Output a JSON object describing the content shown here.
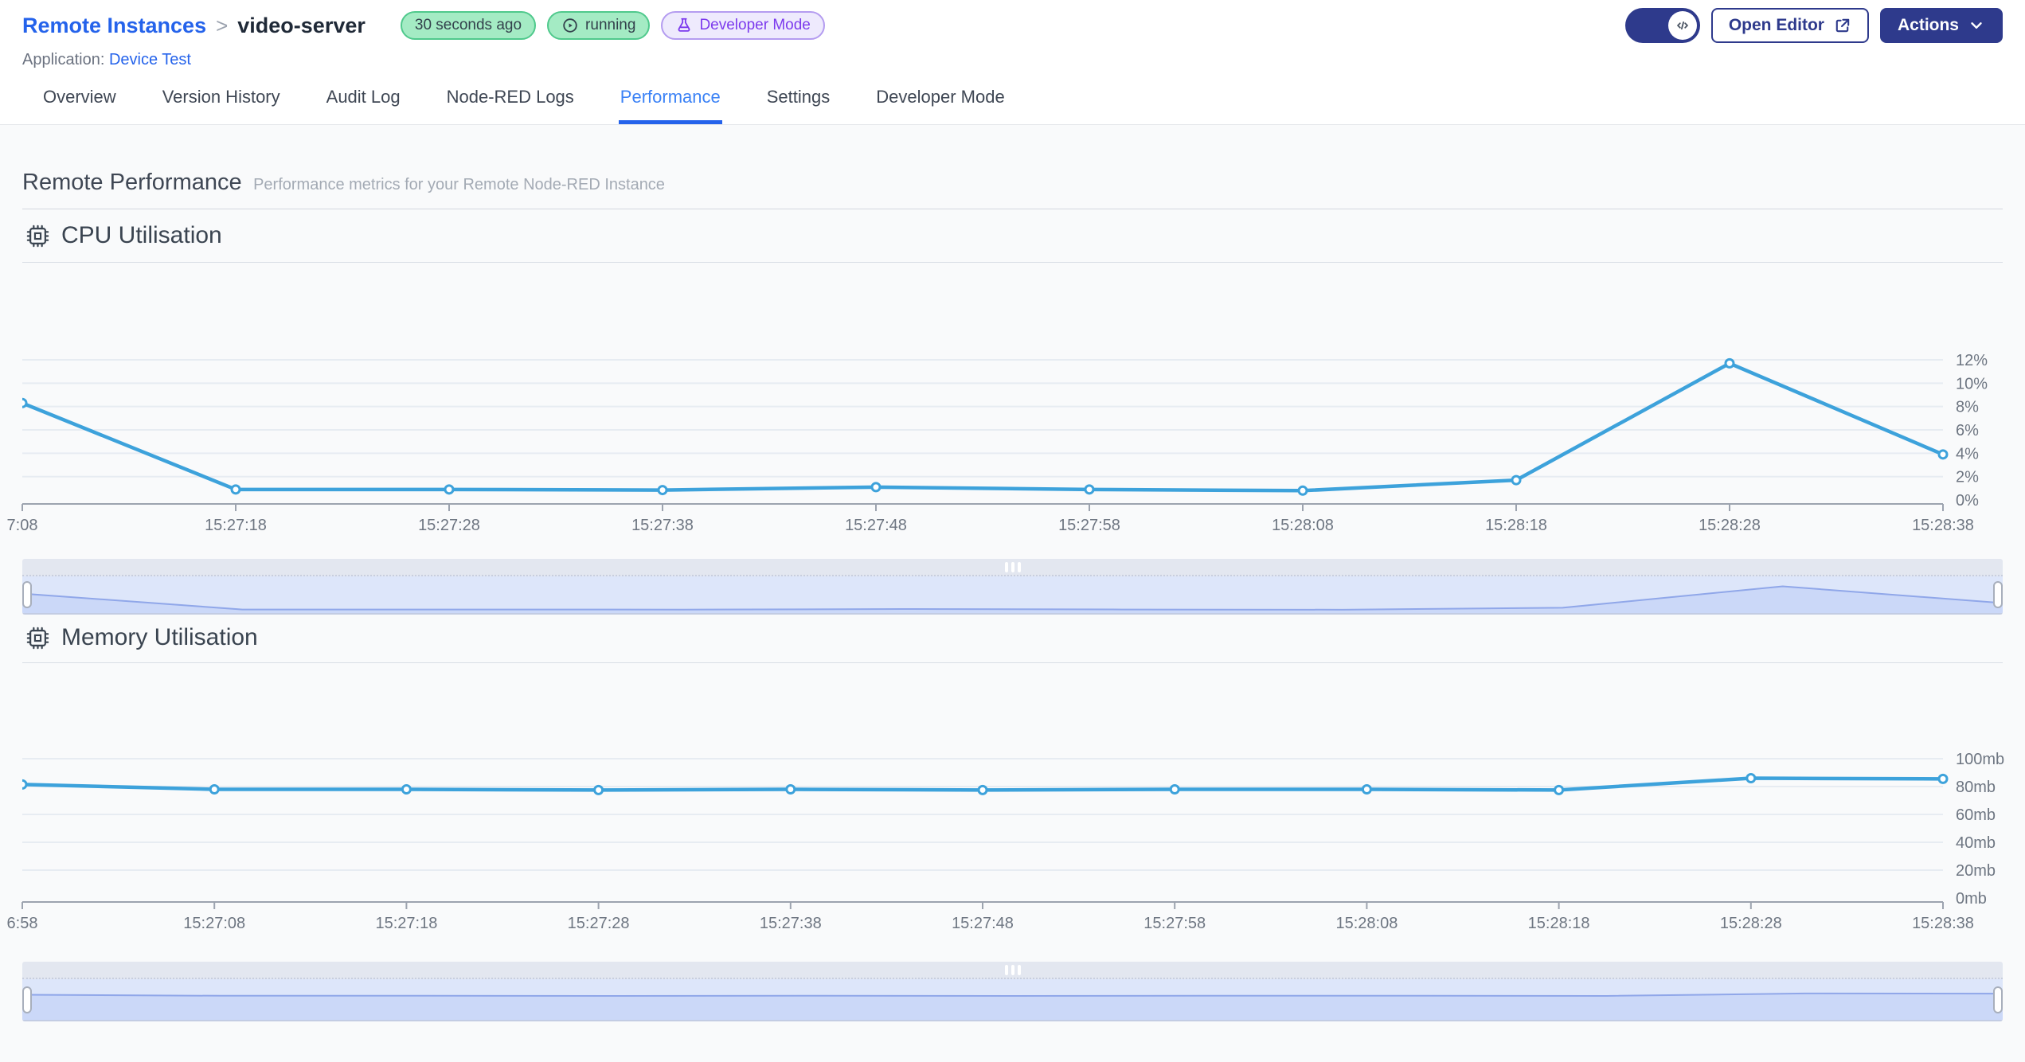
{
  "header": {
    "breadcrumb": {
      "parent": "Remote Instances",
      "separator": ">",
      "current": "video-server"
    },
    "badges": {
      "last_seen": "30 seconds ago",
      "status": "running",
      "mode": "Developer Mode"
    },
    "application_label": "Application:",
    "application_name": "Device Test",
    "buttons": {
      "open_editor": "Open Editor",
      "actions": "Actions"
    }
  },
  "tabs": [
    {
      "label": "Overview",
      "active": false
    },
    {
      "label": "Version History",
      "active": false
    },
    {
      "label": "Audit Log",
      "active": false
    },
    {
      "label": "Node-RED Logs",
      "active": false
    },
    {
      "label": "Performance",
      "active": true
    },
    {
      "label": "Settings",
      "active": false
    },
    {
      "label": "Developer Mode",
      "active": false
    }
  ],
  "page": {
    "title": "Remote Performance",
    "subtitle": "Performance metrics for your Remote Node-RED Instance"
  },
  "chart_data": [
    {
      "type": "line",
      "title": "CPU Utilisation",
      "x_labels": [
        "7:08",
        "15:27:18",
        "15:27:28",
        "15:27:38",
        "15:27:48",
        "15:27:58",
        "15:28:08",
        "15:28:18",
        "15:28:28",
        "15:28:38"
      ],
      "values": [
        8.3,
        0.9,
        0.9,
        0.85,
        1.1,
        0.9,
        0.8,
        1.7,
        11.7,
        3.9
      ],
      "y_ticks": [
        0,
        2,
        4,
        6,
        8,
        10,
        12
      ],
      "y_tick_labels": [
        "0%",
        "2%",
        "4%",
        "6%",
        "8%",
        "10%",
        "12%"
      ],
      "ylim": [
        0,
        12
      ],
      "xlabel": "",
      "ylabel": "",
      "grid": true,
      "legend": "none",
      "y_axis_side": "right",
      "line_style": "solid-with-point-markers"
    },
    {
      "type": "line",
      "title": "Memory Utilisation",
      "x_labels": [
        "6:58",
        "15:27:08",
        "15:27:18",
        "15:27:28",
        "15:27:38",
        "15:27:48",
        "15:27:58",
        "15:28:08",
        "15:28:18",
        "15:28:28",
        "15:28:38"
      ],
      "values": [
        81.5,
        78,
        78,
        77.5,
        78,
        77.5,
        78,
        78,
        77.5,
        86,
        85.5
      ],
      "y_ticks": [
        0,
        20,
        40,
        60,
        80,
        100
      ],
      "y_tick_labels": [
        "0mb",
        "20mb",
        "40mb",
        "60mb",
        "80mb",
        "100mb"
      ],
      "ylim": [
        0,
        100
      ],
      "xlabel": "",
      "ylabel": "",
      "grid": true,
      "legend": "none",
      "y_axis_side": "right",
      "line_style": "solid-with-point-markers"
    }
  ],
  "colors": {
    "link_blue": "#2563EB",
    "active_tab": "#3B82F6",
    "brand_indigo": "#2E3A8C",
    "accent_blue": "#3DA2DB",
    "badge_green_bg": "#A4EBC4",
    "badge_green_border": "#4FC98C",
    "badge_purple_bg": "#EEEAFD",
    "badge_purple_border": "#B49CF0",
    "badge_purple_text": "#7C3AED",
    "brush_area_fill": "#CBD8F8",
    "brush_area_line": "#90A7E9",
    "brush_bg": "#DDE6FA"
  }
}
